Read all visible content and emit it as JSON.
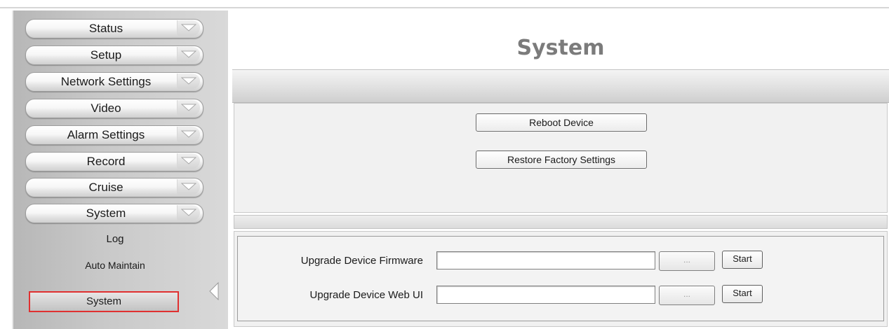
{
  "sidebar": {
    "menu": [
      {
        "label": "Status"
      },
      {
        "label": "Setup"
      },
      {
        "label": "Network Settings"
      },
      {
        "label": "Video"
      },
      {
        "label": "Alarm Settings"
      },
      {
        "label": "Record"
      },
      {
        "label": "Cruise"
      },
      {
        "label": "System"
      }
    ],
    "submenu": [
      {
        "label": "Log"
      },
      {
        "label": "Auto Maintain"
      },
      {
        "label": "System",
        "active": true
      }
    ]
  },
  "main": {
    "title": "System",
    "reboot_label": "Reboot Device",
    "restore_label": "Restore Factory Settings",
    "upgrade": {
      "firmware_label": "Upgrade Device Firmware",
      "webui_label": "Upgrade Device Web UI",
      "firmware_value": "",
      "webui_value": "",
      "browse_label": "...",
      "start_label": "Start"
    }
  },
  "colors": {
    "active_border": "#e03030",
    "title": "#7b7b7b"
  }
}
